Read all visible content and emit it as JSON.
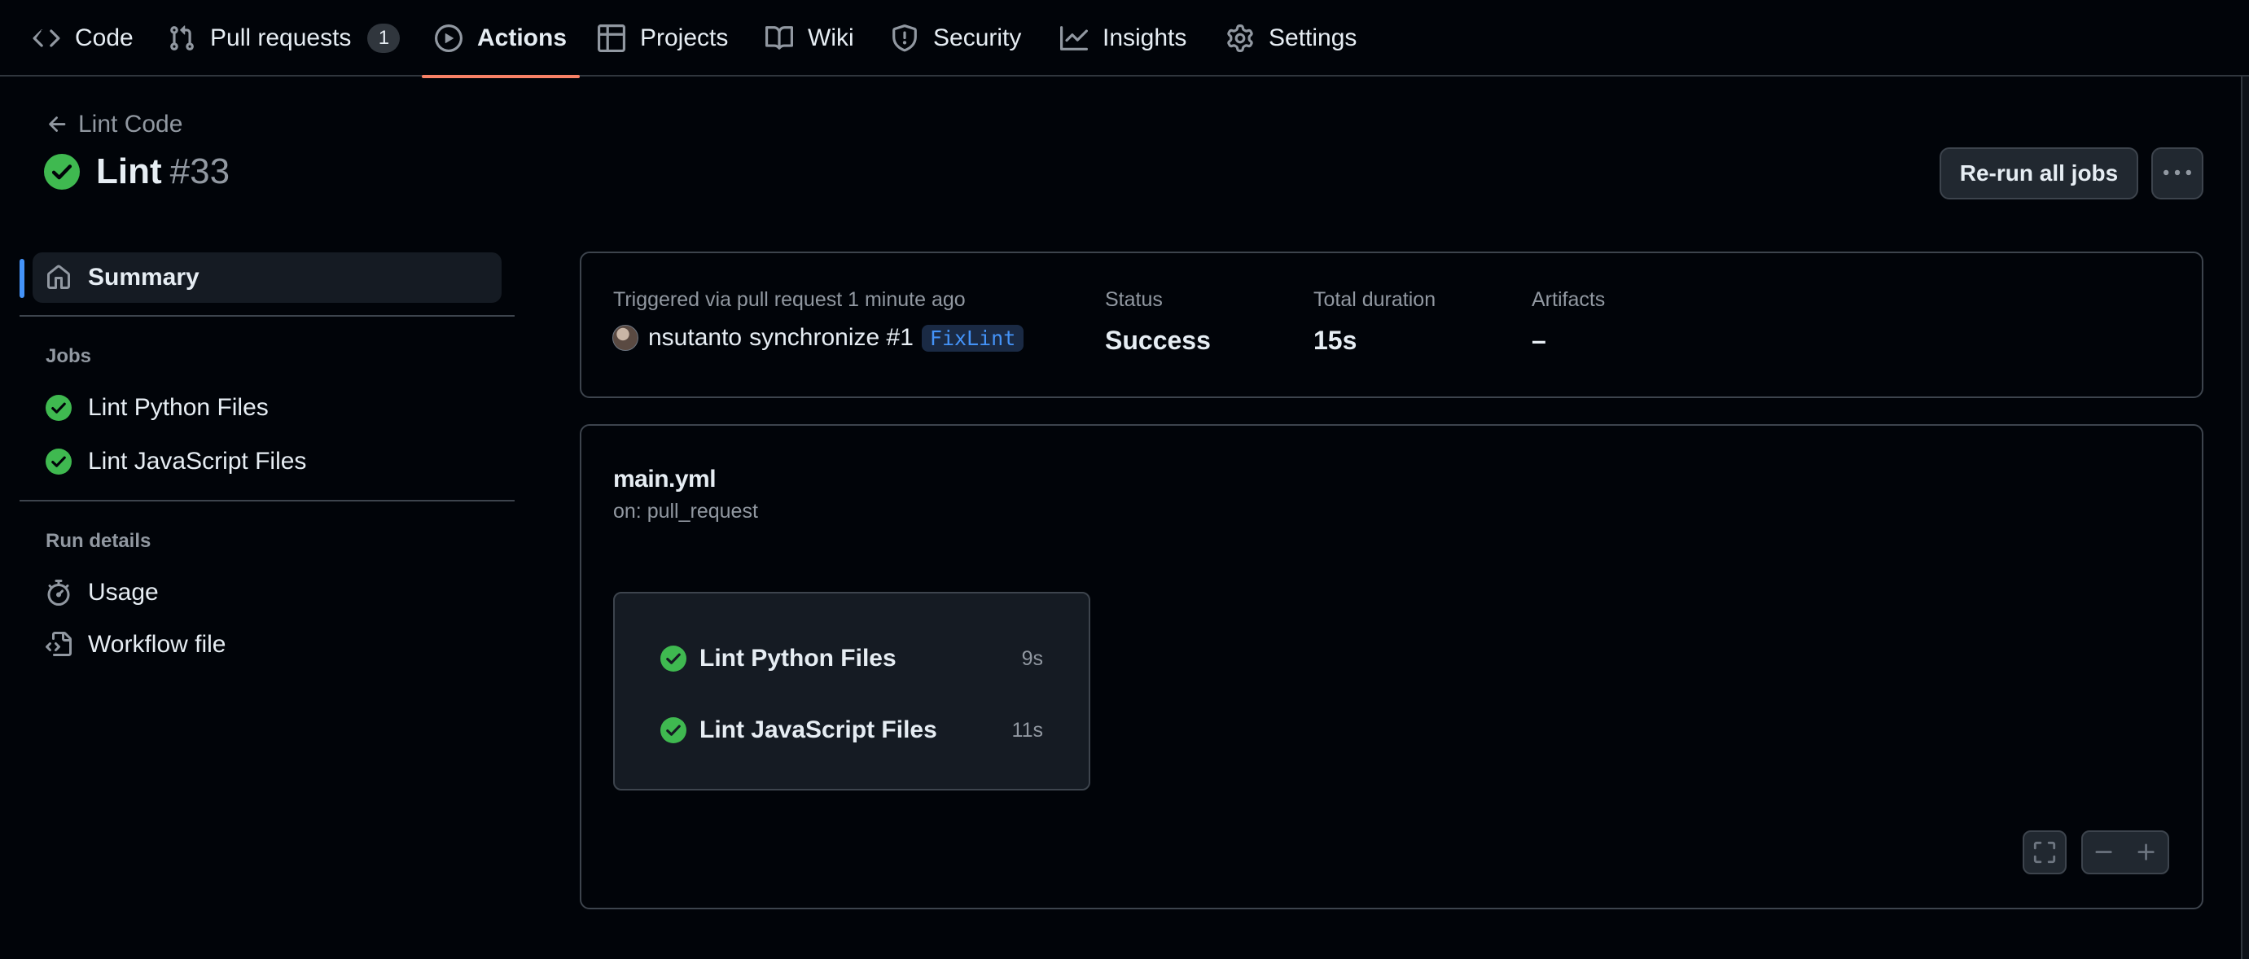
{
  "nav": {
    "tabs": [
      {
        "label": "Code",
        "icon": "code-icon"
      },
      {
        "label": "Pull requests",
        "icon": "git-pull-request-icon",
        "count": "1"
      },
      {
        "label": "Actions",
        "icon": "play-icon",
        "active": true
      },
      {
        "label": "Projects",
        "icon": "table-icon"
      },
      {
        "label": "Wiki",
        "icon": "book-icon"
      },
      {
        "label": "Security",
        "icon": "shield-icon"
      },
      {
        "label": "Insights",
        "icon": "graph-icon"
      },
      {
        "label": "Settings",
        "icon": "gear-icon"
      }
    ]
  },
  "header": {
    "back_label": "Lint Code",
    "run_name": "Lint",
    "run_number": "#33",
    "rerun_label": "Re-run all jobs"
  },
  "sidebar": {
    "summary_label": "Summary",
    "jobs_heading": "Jobs",
    "jobs": [
      {
        "label": "Lint Python Files",
        "status": "success"
      },
      {
        "label": "Lint JavaScript Files",
        "status": "success"
      }
    ],
    "run_details_heading": "Run details",
    "details": [
      {
        "label": "Usage",
        "icon": "stopwatch-icon"
      },
      {
        "label": "Workflow file",
        "icon": "file-code-icon"
      }
    ]
  },
  "summary": {
    "trigger_text": "Triggered via pull request 1 minute ago",
    "actor": "nsutanto",
    "event_text": "synchronize #1",
    "branch": "FixLint",
    "status_label": "Status",
    "status_value": "Success",
    "duration_label": "Total duration",
    "duration_value": "15s",
    "artifacts_label": "Artifacts",
    "artifacts_value": "–"
  },
  "workflow": {
    "file": "main.yml",
    "trigger": "on: pull_request",
    "jobs": [
      {
        "label": "Lint Python Files",
        "duration": "9s"
      },
      {
        "label": "Lint JavaScript Files",
        "duration": "11s"
      }
    ]
  },
  "colors": {
    "background": "#010409",
    "success": "#3fb950",
    "accent": "#4493f8",
    "active_tab_underline": "#f78166"
  }
}
